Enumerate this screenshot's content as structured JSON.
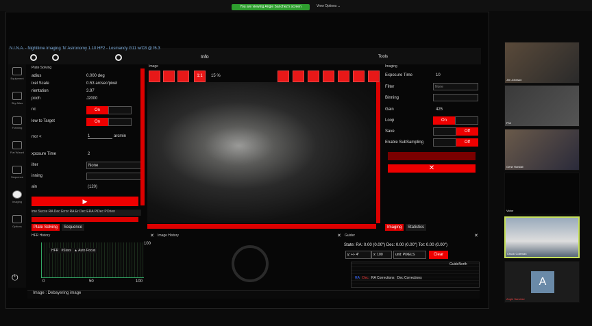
{
  "zoom": {
    "share_banner": "You are viewing Angie Sanchez's screen",
    "view_options": "View Options ⌄"
  },
  "nina": {
    "title": "N.I.N.A. - Nighttime Imaging 'N' Astronomy 1.10 HF2 - Losmandy G11 w/C8 @ f6.3",
    "info": "Info",
    "tools": "Tools"
  },
  "nav": [
    "Equipment",
    "Sky Atlas",
    "Framing",
    "Flat Wizard",
    "Sequence",
    "Imaging",
    "Options"
  ],
  "plate": {
    "title": "Plate Solving",
    "rows": [
      {
        "l": "adius",
        "v": "0.000 deg"
      },
      {
        "l": "ixel Scale",
        "v": "0.53 arcsec/pixel"
      },
      {
        "l": "rientation",
        "v": "3.97"
      },
      {
        "l": "poch",
        "v": "J2000"
      }
    ],
    "sync": "On",
    "slew": "On",
    "error_label": "rror <",
    "error_val": "1",
    "error_unit": "arcmin",
    "exposure_label": "xposure Time",
    "exposure_val": "2",
    "filter_label": "ilter",
    "filter_val": "None",
    "binning_label": "inning",
    "gain_label": "ain",
    "gain_val": "(120)",
    "cols": "ime Succe RA Dec Error RA Er Dec ERA PiDec POrien",
    "tab1": "Plate Solving",
    "tab2": "Sequence"
  },
  "imagepanel": {
    "title": "Image",
    "zoom": "15 %",
    "onebyone": "1:1"
  },
  "imaging": {
    "title": "Imaging",
    "exposure_label": "Exposure Time",
    "exposure_val": "10",
    "filter_label": "Filter",
    "filter_val": "None",
    "binning_label": "Binning",
    "gain_label": "Gain",
    "gain_val": "425",
    "loop_label": "Loop",
    "loop_val": "On",
    "save_label": "Save",
    "save_val": "Off",
    "sub_label": "Enable SubSampling",
    "sub_val": "Off",
    "tab1": "Imaging",
    "tab2": "Statistics"
  },
  "hfr": {
    "title": "HFR History",
    "legend": [
      "HFR",
      "#Stars",
      "Auto Focus"
    ],
    "x0": "0",
    "x50": "50",
    "x100": "100"
  },
  "imghist": {
    "title": "Image History",
    "y100": "100"
  },
  "guider": {
    "title": "Guider",
    "state": "State: RA: 0.00 (0.00\") Dec: 0.00 (0.00\") Tot: 0.00 (0.00\")",
    "y": "y: +/- 4\"",
    "x": "x: 100",
    "unit": "unit: PIXELS",
    "clear": "Clear",
    "north": "GuideNorth",
    "legend": [
      "RA",
      "Dec",
      "RA Corrections",
      "Dec Corrections"
    ]
  },
  "status": {
    "text": "Image :  Debayering image"
  },
  "participants": [
    {
      "name": "Jim Johnson"
    },
    {
      "name": "Phil"
    },
    {
      "name": "Gene Horsfall"
    },
    {
      "name": "Victor"
    },
    {
      "name": "Chuck Coleman"
    },
    {
      "name": "Angie Sanchez",
      "initial": "A"
    }
  ]
}
